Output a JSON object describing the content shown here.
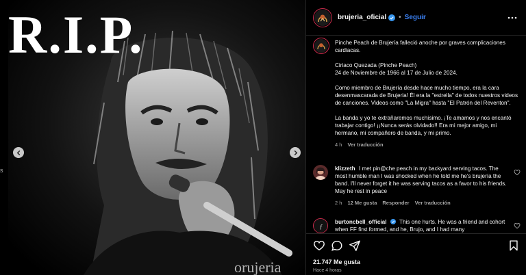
{
  "post": {
    "overlay_text": "R.I.P.",
    "left_edge_fragment": "s"
  },
  "header": {
    "username": "brujeria_oficial",
    "separator": "•",
    "follow_label": "Seguir"
  },
  "caption": {
    "paragraphs": [
      "Pinche Peach de Brujería falleció anoche por graves complicaciones cardiacas.",
      "Ciriaco Quezada (Pinche Peach)\n24 de Noviembre de 1966 al 17 de Julio de 2024.",
      "Como miembro de Brujería desde hace mucho tiempo, era la cara desenmascarada de Brujeria! Él era la \"estrella\" de todos nuestros videos de canciones. Videos como \"La Migra\" hasta \"El Patrón del Reventon\".",
      "La banda y yo te extrañaremos muchísimo. ¡Te amamos y nos encantó trabajar contigo! ¡¡Nunca serás olvidado!! Era mi mejor amigo, mi hermano, mi compañero de banda, y mi primo."
    ],
    "time": "4 h",
    "translation_label": "Ver traducción"
  },
  "comments": [
    {
      "username": "klizzeth",
      "text": "I met pin@che peach in my backyard serving tacos. The most humble man I was shocked when he told me he's brujería the band. I'll never forget it he was serving tacos as a favor to his friends. May he rest in peace",
      "time": "2 h",
      "likes": "12 Me gusta",
      "reply_label": "Responder",
      "translation_label": "Ver traducción"
    },
    {
      "username": "burtoncbell_official",
      "text": "This one hurts. He was a friend and cohort when FF first formed, and he, Brujo, and I had many"
    }
  ],
  "footer": {
    "likes": "21.747 Me gusta",
    "time_ago": "Hace 4 horas"
  },
  "icons": {
    "verified": "verified-badge-icon",
    "more": "more-options-icon",
    "like": "heart-icon",
    "comment": "comment-icon",
    "share": "share-icon",
    "save": "bookmark-icon",
    "prev": "chevron-left-icon",
    "next": "chevron-right-icon"
  },
  "colors": {
    "follow": "#3b82f6",
    "verified": "#3897f0",
    "avatar_ring": "#c92b4b",
    "muted_text": "#a8a8a8",
    "divider": "#262626"
  }
}
